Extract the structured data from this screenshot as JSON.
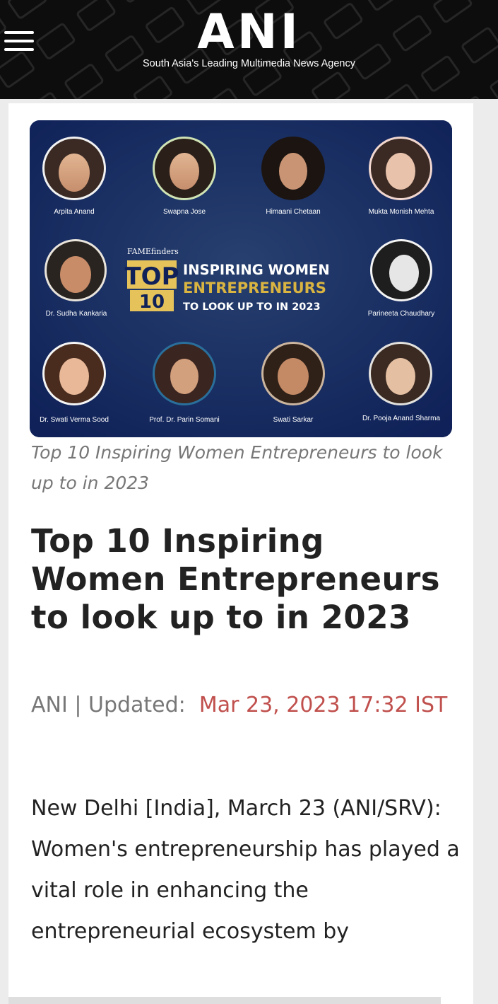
{
  "header": {
    "logo": "ANI",
    "tagline": "South Asia's Leading Multimedia News Agency",
    "background": "#0d0d0d"
  },
  "hero": {
    "badge_brand": "FAMEfinders",
    "badge_top": "TOP",
    "badge_number": "10",
    "headline_line1": "INSPIRING WOMEN",
    "headline_line2": "ENTREPRENEURS",
    "headline_line3": "TO LOOK UP TO IN 2023",
    "people": [
      "Arpita Anand",
      "Swapna Jose",
      "Himaani Chetaan",
      "Mukta Monish Mehta",
      "Dr. Sudha Kankaria",
      "Parineeta Chaudhary",
      "Dr. Swati Verma Sood",
      "Prof. Dr. Parin Somani",
      "Swati Sarkar",
      "Dr. Pooja Anand Sharma"
    ],
    "colors": {
      "background": "#0f2158",
      "gold": "#d9b441",
      "white": "#ffffff"
    }
  },
  "article": {
    "caption": "Top 10 Inspiring Women Entrepreneurs to look up to in 2023",
    "title": "Top 10 Inspiring Women Entrepreneurs to look up to in 2023",
    "byline_prefix": "ANI | Updated:",
    "date": "Mar 23, 2023 17:32 IST",
    "body": "New Delhi [India], March 23 (ANI/SRV): Women's entrepreneurship has played a vital role in enhancing the entrepreneurial ecosystem by",
    "date_color": "#c0504d"
  }
}
